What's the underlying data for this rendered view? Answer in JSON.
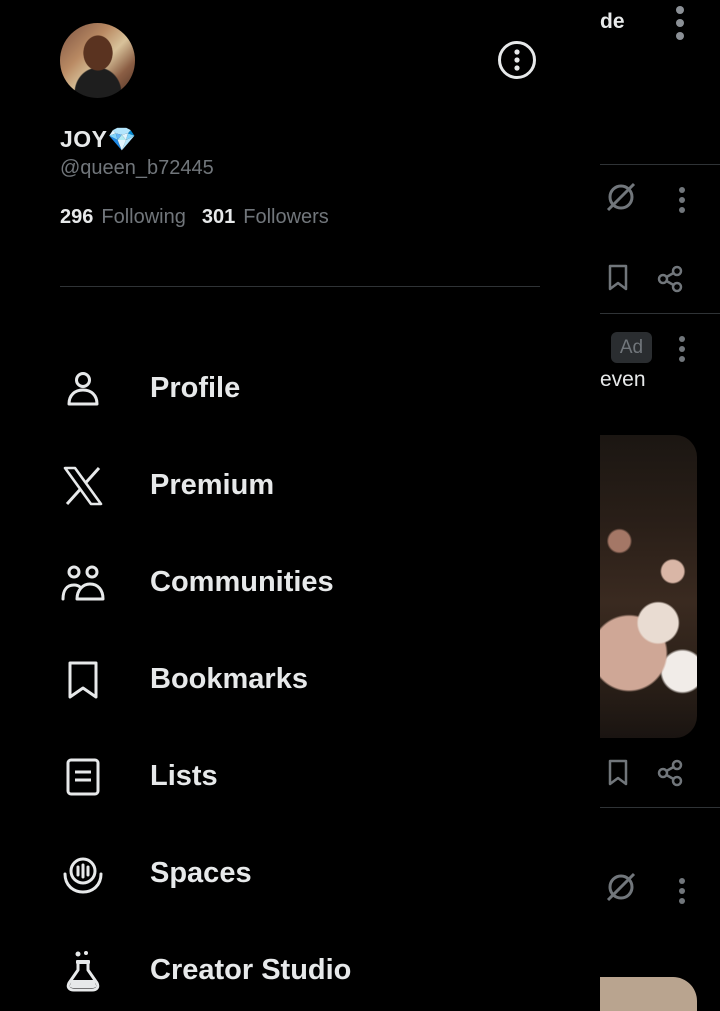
{
  "feed": {
    "partial_top_text": "de",
    "ad_label": "Ad",
    "partial_ad_text": "even"
  },
  "profile": {
    "display_name": "JOY💎",
    "handle": "@queen_b72445",
    "following_count": "296",
    "following_label": "Following",
    "followers_count": "301",
    "followers_label": "Followers",
    "avatar_icon": "avatar-photo",
    "more_icon": "more-options-circle-icon"
  },
  "menu": {
    "items": [
      {
        "label": "Profile",
        "icon": "person-icon"
      },
      {
        "label": "Premium",
        "icon": "x-logo-icon"
      },
      {
        "label": "Communities",
        "icon": "communities-icon"
      },
      {
        "label": "Bookmarks",
        "icon": "bookmark-icon"
      },
      {
        "label": "Lists",
        "icon": "list-icon"
      },
      {
        "label": "Spaces",
        "icon": "spaces-icon"
      },
      {
        "label": "Creator Studio",
        "icon": "flask-icon"
      }
    ]
  },
  "colors": {
    "background": "#000000",
    "text_primary": "#e7e9ea",
    "text_secondary": "#71767b",
    "divider": "#2f3336"
  }
}
